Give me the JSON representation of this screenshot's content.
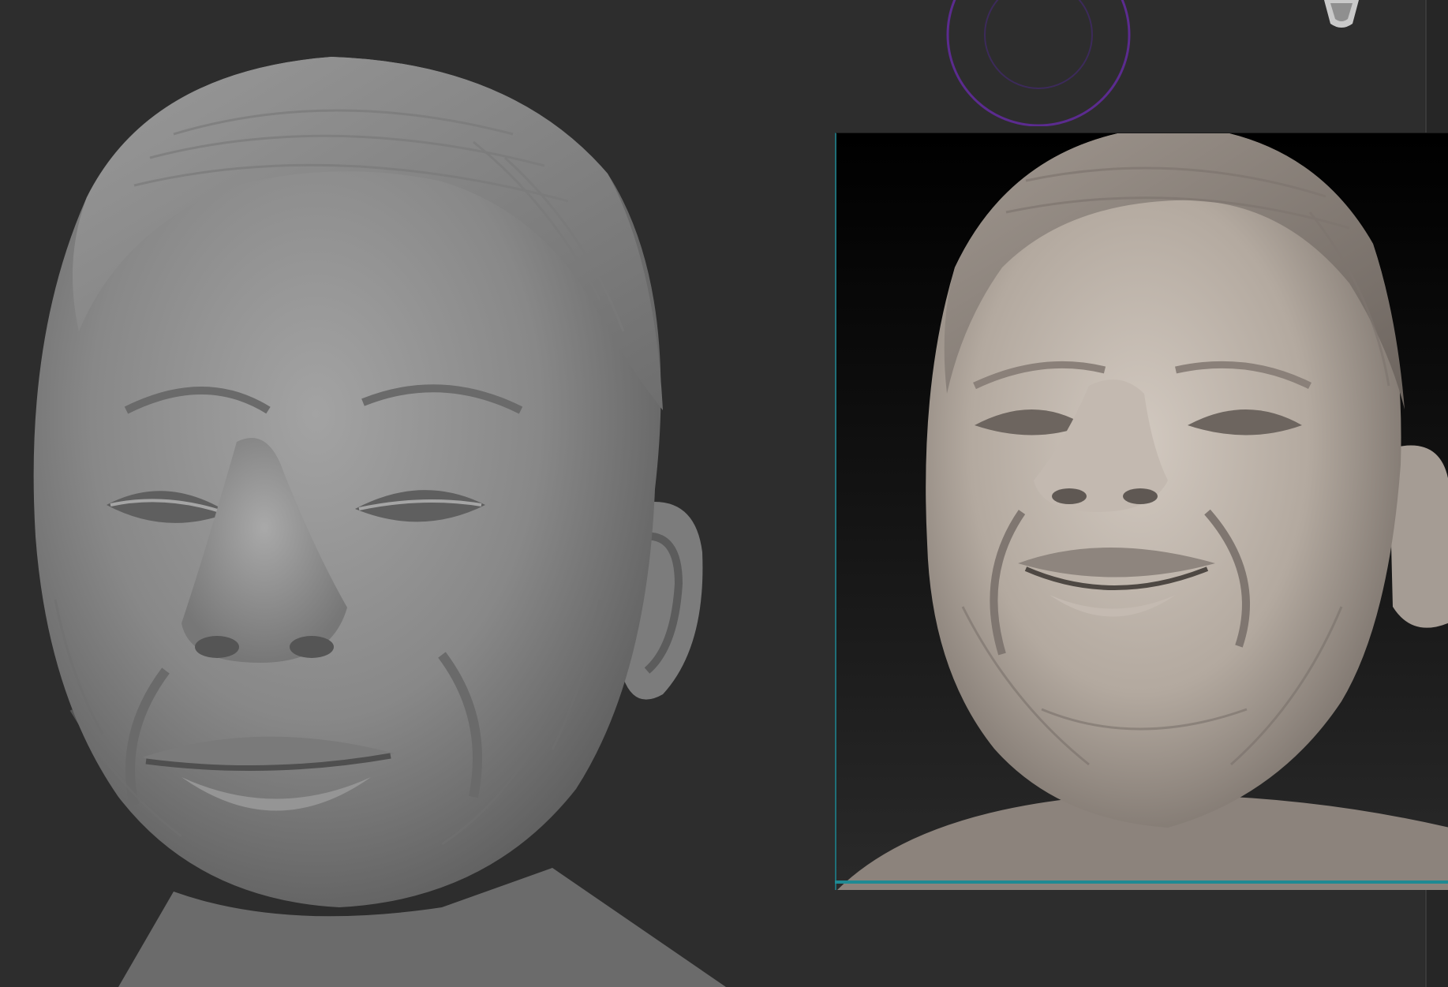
{
  "app": {
    "title": ""
  },
  "viewport": {
    "background_color": "#2d2d2d",
    "main_model_name": "",
    "reference_image_name": ""
  },
  "colors": {
    "canvas": "#2d2d2d",
    "reference_frame_accent": "#1f8a93",
    "brush_cursor": "#5b2b8f",
    "clay_grey": "#8c8c8c",
    "reference_clay": "#b9afa6"
  },
  "icons": {
    "brush_cursor": "brush-cursor-icon",
    "navigation_gizmo": "navigation-gizmo-icon"
  }
}
